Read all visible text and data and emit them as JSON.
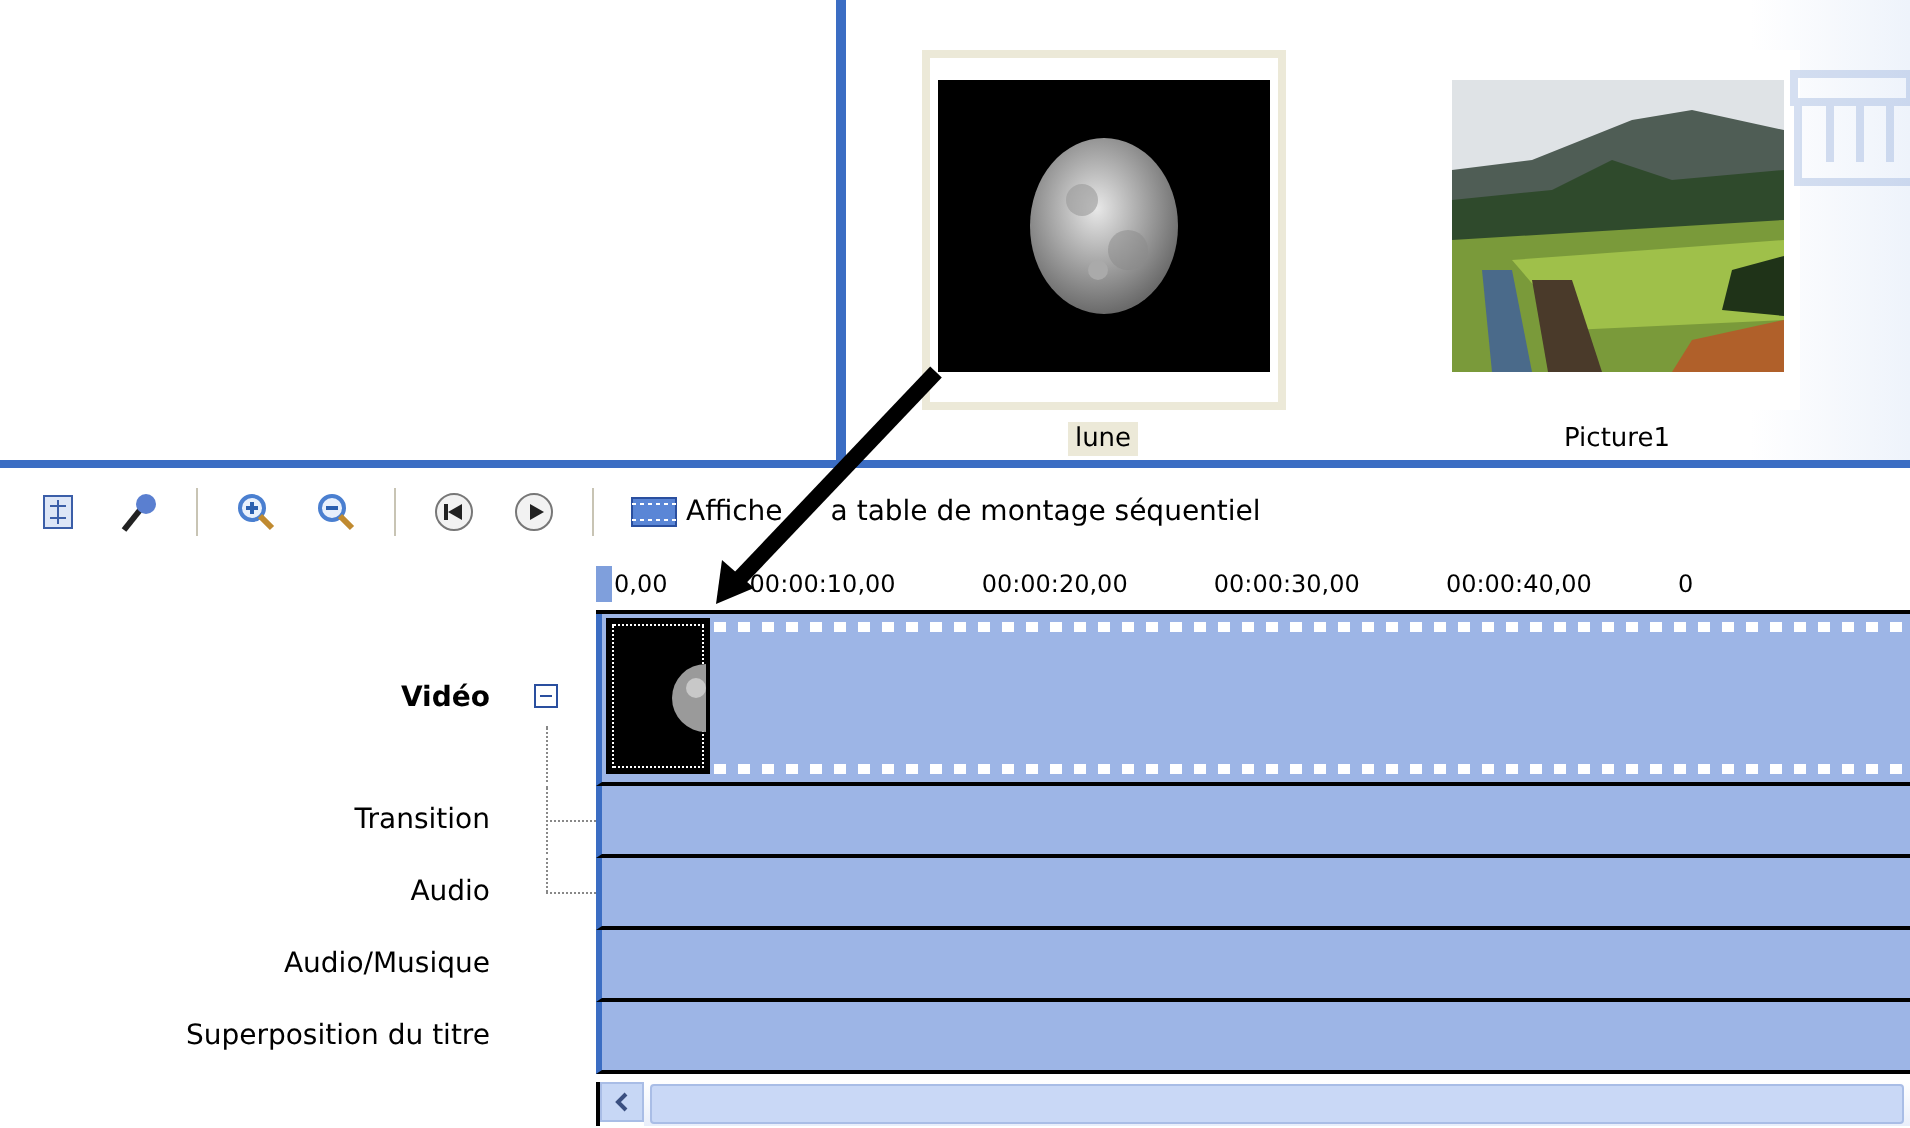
{
  "clips": [
    {
      "name": "lune",
      "kind": "moon",
      "selected": true
    },
    {
      "name": "Picture1",
      "kind": "landscape",
      "selected": false
    }
  ],
  "toolbar": {
    "storyboard_label": [
      "Affiche",
      "a table de montage séquentiel"
    ]
  },
  "ruler": {
    "ticks": [
      "0,00",
      "00:00:10,00",
      "00:00:20,00",
      "00:00:30,00",
      "00:00:40,00",
      "0"
    ]
  },
  "tracks": [
    {
      "label": "Vidéo",
      "kind": "video",
      "expanded": true
    },
    {
      "label": "Transition",
      "kind": "child"
    },
    {
      "label": "Audio",
      "kind": "child"
    },
    {
      "label": "Audio/Musique",
      "kind": "plain"
    },
    {
      "label": "Superposition du titre",
      "kind": "plain"
    }
  ]
}
